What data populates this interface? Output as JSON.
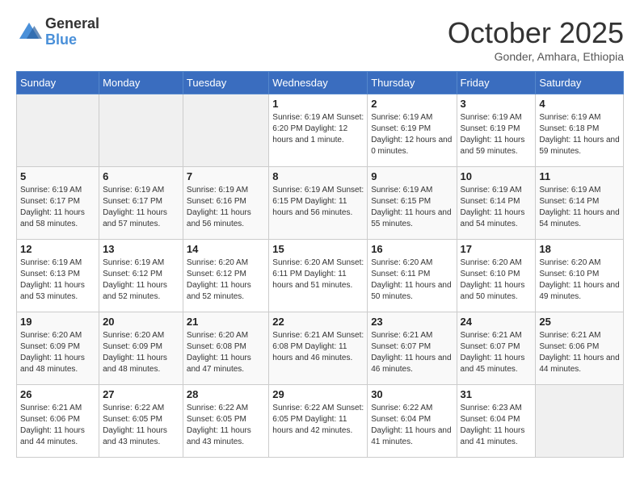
{
  "header": {
    "logo_line1": "General",
    "logo_line2": "Blue",
    "month": "October 2025",
    "location": "Gonder, Amhara, Ethiopia"
  },
  "columns": [
    "Sunday",
    "Monday",
    "Tuesday",
    "Wednesday",
    "Thursday",
    "Friday",
    "Saturday"
  ],
  "weeks": [
    [
      {
        "day": "",
        "info": ""
      },
      {
        "day": "",
        "info": ""
      },
      {
        "day": "",
        "info": ""
      },
      {
        "day": "1",
        "info": "Sunrise: 6:19 AM\nSunset: 6:20 PM\nDaylight: 12 hours\nand 1 minute."
      },
      {
        "day": "2",
        "info": "Sunrise: 6:19 AM\nSunset: 6:19 PM\nDaylight: 12 hours\nand 0 minutes."
      },
      {
        "day": "3",
        "info": "Sunrise: 6:19 AM\nSunset: 6:19 PM\nDaylight: 11 hours\nand 59 minutes."
      },
      {
        "day": "4",
        "info": "Sunrise: 6:19 AM\nSunset: 6:18 PM\nDaylight: 11 hours\nand 59 minutes."
      }
    ],
    [
      {
        "day": "5",
        "info": "Sunrise: 6:19 AM\nSunset: 6:17 PM\nDaylight: 11 hours\nand 58 minutes."
      },
      {
        "day": "6",
        "info": "Sunrise: 6:19 AM\nSunset: 6:17 PM\nDaylight: 11 hours\nand 57 minutes."
      },
      {
        "day": "7",
        "info": "Sunrise: 6:19 AM\nSunset: 6:16 PM\nDaylight: 11 hours\nand 56 minutes."
      },
      {
        "day": "8",
        "info": "Sunrise: 6:19 AM\nSunset: 6:15 PM\nDaylight: 11 hours\nand 56 minutes."
      },
      {
        "day": "9",
        "info": "Sunrise: 6:19 AM\nSunset: 6:15 PM\nDaylight: 11 hours\nand 55 minutes."
      },
      {
        "day": "10",
        "info": "Sunrise: 6:19 AM\nSunset: 6:14 PM\nDaylight: 11 hours\nand 54 minutes."
      },
      {
        "day": "11",
        "info": "Sunrise: 6:19 AM\nSunset: 6:14 PM\nDaylight: 11 hours\nand 54 minutes."
      }
    ],
    [
      {
        "day": "12",
        "info": "Sunrise: 6:19 AM\nSunset: 6:13 PM\nDaylight: 11 hours\nand 53 minutes."
      },
      {
        "day": "13",
        "info": "Sunrise: 6:19 AM\nSunset: 6:12 PM\nDaylight: 11 hours\nand 52 minutes."
      },
      {
        "day": "14",
        "info": "Sunrise: 6:20 AM\nSunset: 6:12 PM\nDaylight: 11 hours\nand 52 minutes."
      },
      {
        "day": "15",
        "info": "Sunrise: 6:20 AM\nSunset: 6:11 PM\nDaylight: 11 hours\nand 51 minutes."
      },
      {
        "day": "16",
        "info": "Sunrise: 6:20 AM\nSunset: 6:11 PM\nDaylight: 11 hours\nand 50 minutes."
      },
      {
        "day": "17",
        "info": "Sunrise: 6:20 AM\nSunset: 6:10 PM\nDaylight: 11 hours\nand 50 minutes."
      },
      {
        "day": "18",
        "info": "Sunrise: 6:20 AM\nSunset: 6:10 PM\nDaylight: 11 hours\nand 49 minutes."
      }
    ],
    [
      {
        "day": "19",
        "info": "Sunrise: 6:20 AM\nSunset: 6:09 PM\nDaylight: 11 hours\nand 48 minutes."
      },
      {
        "day": "20",
        "info": "Sunrise: 6:20 AM\nSunset: 6:09 PM\nDaylight: 11 hours\nand 48 minutes."
      },
      {
        "day": "21",
        "info": "Sunrise: 6:20 AM\nSunset: 6:08 PM\nDaylight: 11 hours\nand 47 minutes."
      },
      {
        "day": "22",
        "info": "Sunrise: 6:21 AM\nSunset: 6:08 PM\nDaylight: 11 hours\nand 46 minutes."
      },
      {
        "day": "23",
        "info": "Sunrise: 6:21 AM\nSunset: 6:07 PM\nDaylight: 11 hours\nand 46 minutes."
      },
      {
        "day": "24",
        "info": "Sunrise: 6:21 AM\nSunset: 6:07 PM\nDaylight: 11 hours\nand 45 minutes."
      },
      {
        "day": "25",
        "info": "Sunrise: 6:21 AM\nSunset: 6:06 PM\nDaylight: 11 hours\nand 44 minutes."
      }
    ],
    [
      {
        "day": "26",
        "info": "Sunrise: 6:21 AM\nSunset: 6:06 PM\nDaylight: 11 hours\nand 44 minutes."
      },
      {
        "day": "27",
        "info": "Sunrise: 6:22 AM\nSunset: 6:05 PM\nDaylight: 11 hours\nand 43 minutes."
      },
      {
        "day": "28",
        "info": "Sunrise: 6:22 AM\nSunset: 6:05 PM\nDaylight: 11 hours\nand 43 minutes."
      },
      {
        "day": "29",
        "info": "Sunrise: 6:22 AM\nSunset: 6:05 PM\nDaylight: 11 hours\nand 42 minutes."
      },
      {
        "day": "30",
        "info": "Sunrise: 6:22 AM\nSunset: 6:04 PM\nDaylight: 11 hours\nand 41 minutes."
      },
      {
        "day": "31",
        "info": "Sunrise: 6:23 AM\nSunset: 6:04 PM\nDaylight: 11 hours\nand 41 minutes."
      },
      {
        "day": "",
        "info": ""
      }
    ]
  ]
}
